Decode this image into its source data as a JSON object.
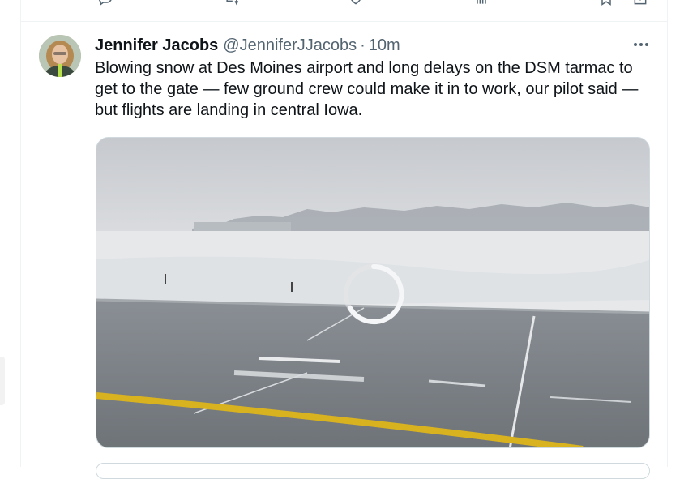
{
  "tweet": {
    "author_name": "Jennifer Jacobs",
    "handle": "@JenniferJJacobs",
    "separator": "·",
    "timestamp": "10m",
    "text": "Blowing snow at Des Moines airport and long delays on the DSM tarmac to get to the gate — few ground crew could make it in to work, our pilot said — but flights are landing in central Iowa.",
    "more_icon": "more-horizontal-icon",
    "media": {
      "type": "video",
      "state": "loading",
      "icon": "loading-spinner-icon"
    }
  },
  "previous_tweet_actions": {
    "icons": [
      "reply-icon",
      "retweet-icon",
      "like-icon",
      "views-icon",
      "bookmark-icon",
      "share-icon"
    ]
  },
  "colors": {
    "text_primary": "#0f1419",
    "text_secondary": "#536471",
    "border": "#eff3f4",
    "runway_line": "#d9b21f"
  }
}
